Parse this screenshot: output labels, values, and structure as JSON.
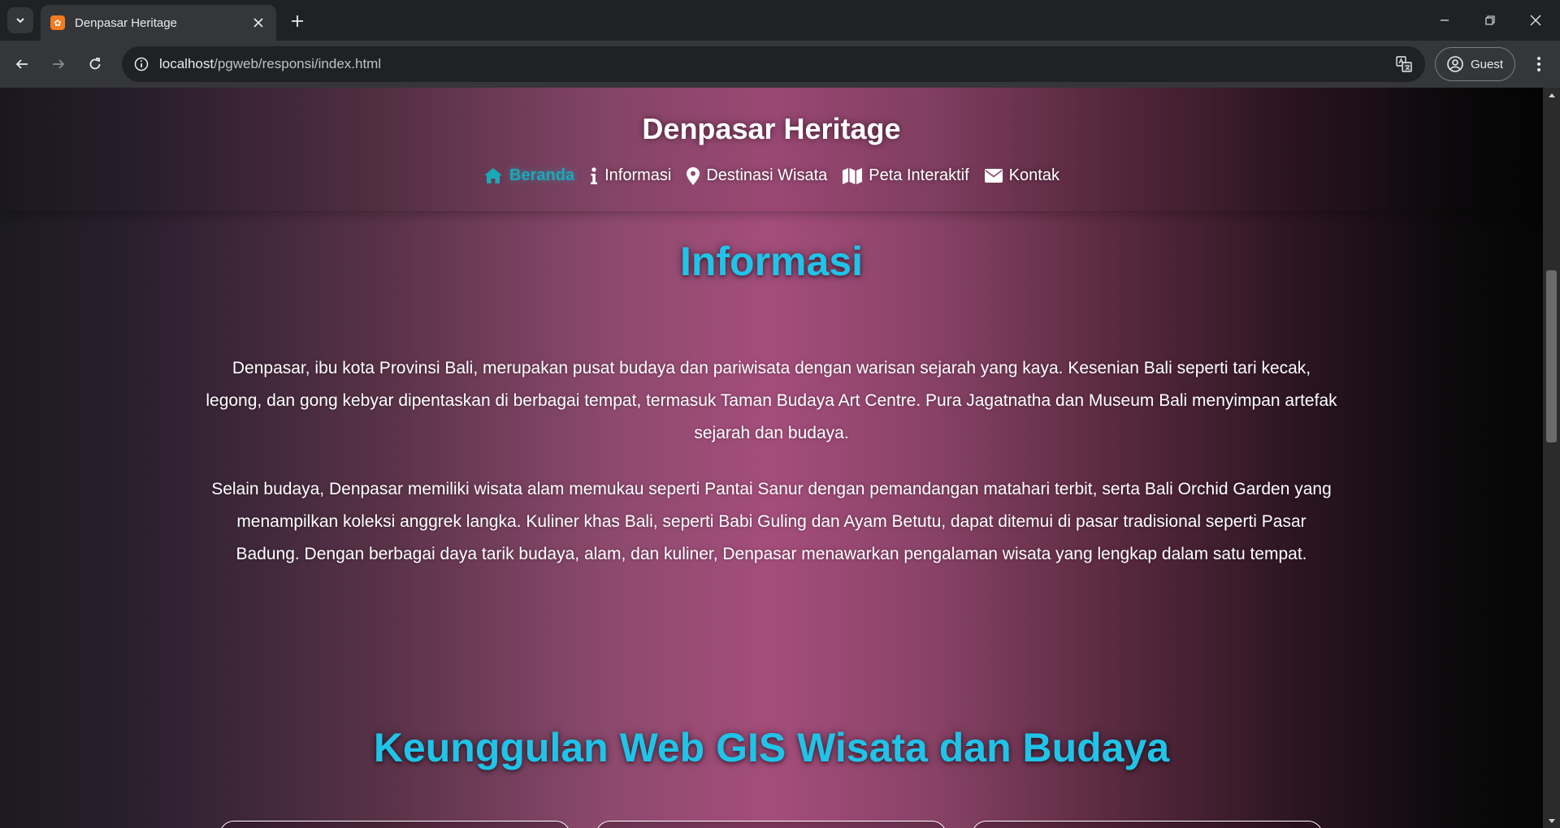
{
  "browser": {
    "tab_title": "Denpasar Heritage",
    "favicon_text": "✿",
    "url_host": "localhost",
    "url_path": "/pgweb/responsi/index.html",
    "profile_label": "Guest"
  },
  "header": {
    "title": "Denpasar Heritage",
    "nav": [
      {
        "label": "Beranda",
        "icon": "home-icon",
        "active": true
      },
      {
        "label": "Informasi",
        "icon": "info-icon",
        "active": false
      },
      {
        "label": "Destinasi Wisata",
        "icon": "map-pin-icon",
        "active": false
      },
      {
        "label": "Peta Interaktif",
        "icon": "map-icon",
        "active": false
      },
      {
        "label": "Kontak",
        "icon": "envelope-icon",
        "active": false
      }
    ]
  },
  "informasi": {
    "title": "Informasi",
    "paragraphs": [
      "Denpasar, ibu kota Provinsi Bali, merupakan pusat budaya dan pariwisata dengan warisan sejarah yang kaya. Kesenian Bali seperti tari kecak, legong, dan gong kebyar dipentaskan di berbagai tempat, termasuk Taman Budaya Art Centre. Pura Jagatnatha dan Museum Bali menyimpan artefak sejarah dan budaya.",
      "Selain budaya, Denpasar memiliki wisata alam memukau seperti Pantai Sanur dengan pemandangan matahari terbit, serta Bali Orchid Garden yang menampilkan koleksi anggrek langka. Kuliner khas Bali, seperti Babi Guling dan Ayam Betutu, dapat ditemui di pasar tradisional seperti Pasar Badung. Dengan berbagai daya tarik budaya, alam, dan kuliner, Denpasar menawarkan pengalaman wisata yang lengkap dalam satu tempat."
    ]
  },
  "keunggulan": {
    "title": "Keunggulan Web GIS Wisata dan Budaya"
  },
  "colors": {
    "accent": "#1fc4e8",
    "nav_active": "#18aab8",
    "background_center": "#a44d7b"
  }
}
